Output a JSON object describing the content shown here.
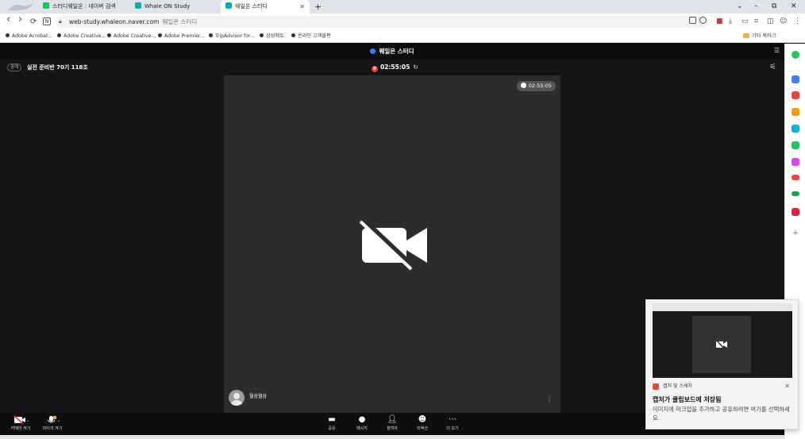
{
  "browser": {
    "tabs": [
      {
        "title": "스터디웨일온 : 네이버 검색",
        "favicon_color": "#03c75a"
      },
      {
        "title": "Whale ON Study",
        "favicon_color": "#00b3a4"
      },
      {
        "title": "웨일온 스터디",
        "favicon_color": "#00b3a4"
      }
    ],
    "new_tab": "+",
    "window_controls": {
      "menu": "⌄",
      "minimize": "–",
      "restore": "⧉",
      "close": "✕"
    },
    "nav": {
      "back": "‹",
      "forward": "›",
      "reload": "⟳",
      "naver": "N"
    },
    "address": {
      "url": "web-study.whaleon.naver.com",
      "page_title": "웨일온 스터디"
    },
    "bookmarks": [
      "Adobe Acrobat...",
      "Adobe Creative...",
      "Adobe Creative...",
      "Adobe Premier...",
      "TripAdvisor for...",
      "삼성에듀",
      "온라인 고객불편"
    ],
    "other_bookmarks": "기타 북마크"
  },
  "app": {
    "title": "웨일온 스터디",
    "public_badge": "공개",
    "room_name": "실전 준비반 70기 118조",
    "recording_badge": "R",
    "elapsed_time": "02:55:05",
    "video_timer": "02:55:05",
    "participant_name": "월삼월삼",
    "toolbar": {
      "camera_label": "카메라 켜기",
      "mic_label": "마이크 켜기",
      "share_label": "공유",
      "message_label": "메시지",
      "participants_label": "참여자",
      "reaction_label": "리액션",
      "more_label": "더 보기"
    }
  },
  "notification": {
    "app_name": "캡처 및 스케치",
    "title": "캡처가 클립보드에 저장됨",
    "body": "이미지에 마크업을 추가하고 공유하려면 여기를 선택하세요."
  },
  "colors": {
    "accent_blue": "#3b82f6",
    "record_red": "#e53935",
    "naver_green": "#03c75a"
  }
}
